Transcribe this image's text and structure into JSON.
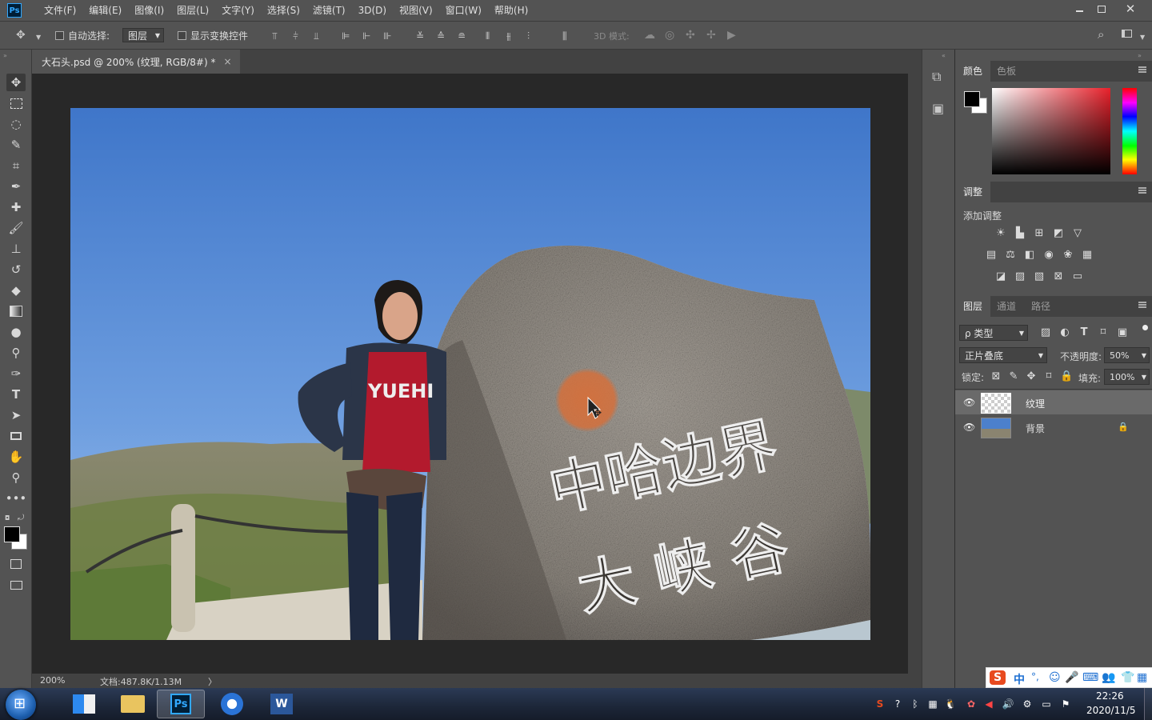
{
  "app": {
    "logo": "Ps"
  },
  "menu": [
    "文件(F)",
    "编辑(E)",
    "图像(I)",
    "图层(L)",
    "文字(Y)",
    "选择(S)",
    "滤镜(T)",
    "3D(D)",
    "视图(V)",
    "窗口(W)",
    "帮助(H)"
  ],
  "options": {
    "auto_select_label": "自动选择:",
    "auto_select_value": "图层",
    "show_transform_label": "显示变换控件",
    "mode_3d_label": "3D 模式:"
  },
  "document": {
    "tab_title": "大石头.psd @ 200% (纹理, RGB/8#) *",
    "close": "×"
  },
  "status": {
    "zoom": "200%",
    "doc_info": "文档:487.8K/1.13M",
    "arrow": "〉"
  },
  "panels": {
    "color": {
      "tabs": [
        "颜色",
        "色板"
      ]
    },
    "adjustments": {
      "tab": "调整",
      "add_label": "添加调整"
    },
    "layers": {
      "tabs": [
        "图层",
        "通道",
        "路径"
      ],
      "filter_kind": "ρ 类型",
      "blend_mode": "正片叠底",
      "opacity_label": "不透明度:",
      "opacity_value": "50%",
      "lock_label": "锁定:",
      "fill_label": "填充:",
      "fill_value": "100%",
      "items": [
        {
          "name": "纹理",
          "selected": true
        },
        {
          "name": "背景",
          "selected": false,
          "locked": true
        }
      ]
    }
  },
  "photo": {
    "rock_text_line1": "中哈边界",
    "rock_text_line2": "大 峡 谷",
    "shirt_text": "YUEHI"
  },
  "ime": {
    "label": "中"
  },
  "taskbar": {
    "time": "22:26",
    "date": "2020/11/5"
  },
  "colors": {
    "ui_bg": "#535353",
    "panel_dark": "#424242",
    "canvas_bg": "#282828",
    "accent": "#31a8ff",
    "brush_cursor": "#d4703c"
  }
}
